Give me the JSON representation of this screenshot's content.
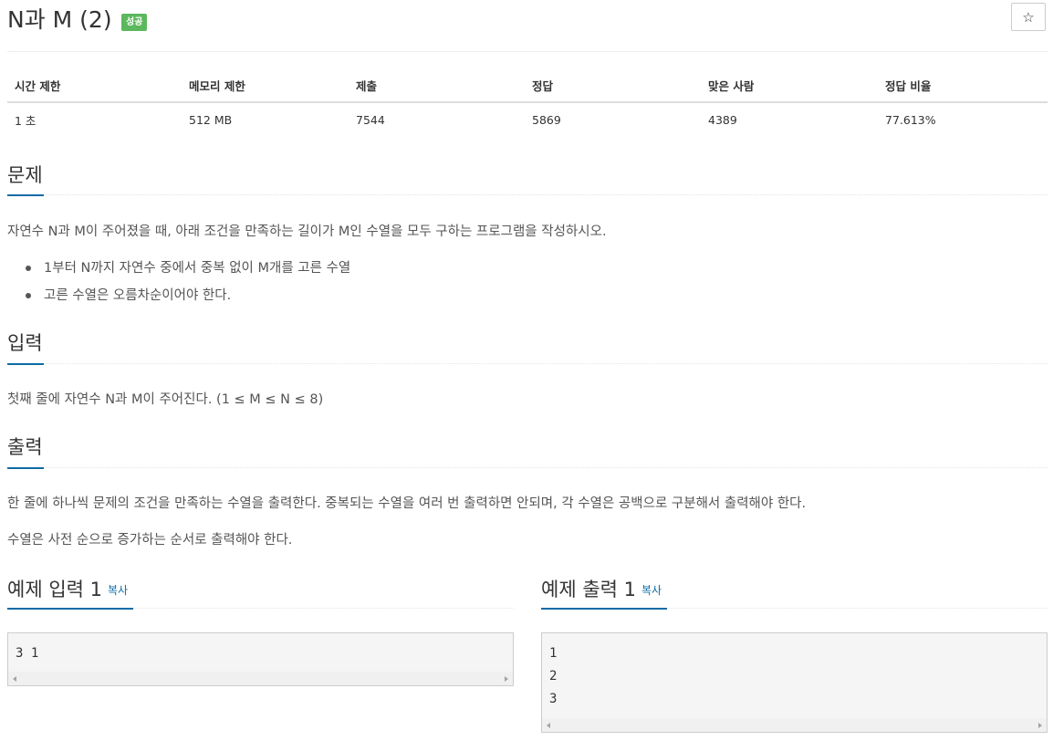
{
  "problem": {
    "title": "N과 M (2)",
    "status_badge": "성공",
    "star_icon": "☆"
  },
  "stats": {
    "headers": [
      "시간 제한",
      "메모리 제한",
      "제출",
      "정답",
      "맞은 사람",
      "정답 비율"
    ],
    "values": [
      "1 초",
      "512 MB",
      "7544",
      "5869",
      "4389",
      "77.613%"
    ]
  },
  "sections": {
    "description": {
      "heading": "문제",
      "text": "자연수 N과 M이 주어졌을 때, 아래 조건을 만족하는 길이가 M인 수열을 모두 구하는 프로그램을 작성하시오.",
      "bullets": [
        "1부터 N까지 자연수 중에서 중복 없이 M개를 고른 수열",
        "고른 수열은 오름차순이어야 한다."
      ]
    },
    "input": {
      "heading": "입력",
      "text": "첫째 줄에 자연수 N과 M이 주어진다. (1 ≤ M ≤ N ≤ 8)"
    },
    "output": {
      "heading": "출력",
      "text1": "한 줄에 하나씩 문제의 조건을 만족하는 수열을 출력한다. 중복되는 수열을 여러 번 출력하면 안되며, 각 수열은 공백으로 구분해서 출력해야 한다.",
      "text2": "수열은 사전 순으로 증가하는 순서로 출력해야 한다."
    }
  },
  "samples": {
    "input": {
      "heading": "예제 입력 1",
      "copy_label": "복사",
      "lines": [
        "3 1"
      ]
    },
    "output": {
      "heading": "예제 출력 1",
      "copy_label": "복사",
      "lines": [
        "1",
        "2",
        "3"
      ]
    }
  },
  "colors": {
    "accent": "#0d6ba4",
    "success": "#5cb85c"
  }
}
